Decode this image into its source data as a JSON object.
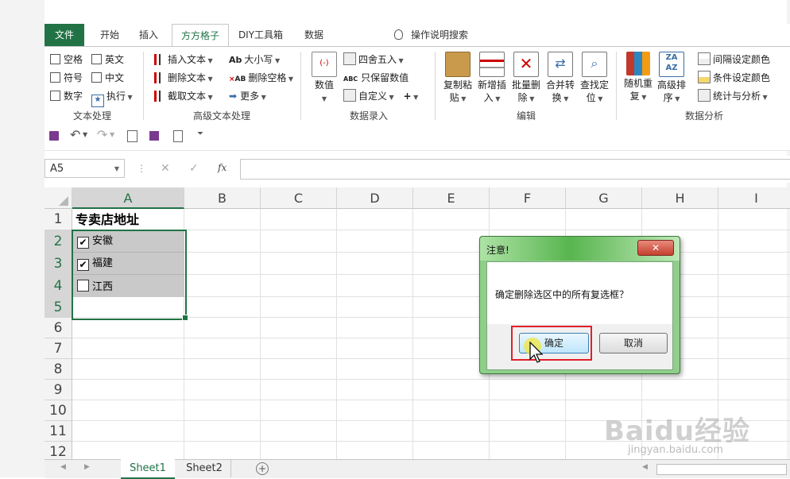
{
  "tabs": [
    "文件",
    "开始",
    "插入",
    "方方格子",
    "DIY工具箱",
    "数据"
  ],
  "tell_me": "操作说明搜索",
  "ribbon": {
    "text_group": {
      "label": "文本处理",
      "items": [
        "空格",
        "英文",
        "符号",
        "中文",
        "数字",
        "执行"
      ]
    },
    "adv_group": {
      "label": "高级文本处理",
      "items": [
        "插入文本",
        "删除文本",
        "截取文本",
        "大小写",
        "删除空格",
        "更多"
      ]
    },
    "num_group": {
      "label": "数据录入",
      "big": "数值",
      "items": [
        "四舍五入",
        "只保留数值",
        "自定义"
      ]
    },
    "edit_group": {
      "label": "编辑",
      "buttons": [
        [
          "复制粘",
          "贴"
        ],
        [
          "新增插",
          "入"
        ],
        [
          "批量删",
          "除"
        ],
        [
          "合并转",
          "换"
        ],
        [
          "查找定",
          "位"
        ]
      ]
    },
    "analysis_group": {
      "label": "数据分析",
      "buttons": [
        [
          "随机重",
          "复"
        ],
        [
          "高级排",
          "序"
        ]
      ],
      "items": [
        "间隔设定颜色",
        "条件设定颜色",
        "统计与分析"
      ]
    }
  },
  "name_box": "A5",
  "fx": "fx",
  "columns": [
    "A",
    "B",
    "C",
    "D",
    "E",
    "F",
    "G",
    "H",
    "I"
  ],
  "rows": [
    "1",
    "2",
    "3",
    "4",
    "5",
    "6",
    "7",
    "8",
    "9",
    "10",
    "11",
    "12"
  ],
  "cells": {
    "a1": "专卖店地址",
    "a2": "安徽",
    "a3": "福建",
    "a4": "江西"
  },
  "checks": {
    "a2": true,
    "a3": true,
    "a4": false
  },
  "sheets": [
    "Sheet1",
    "Sheet2"
  ],
  "dialog": {
    "title": "注意!",
    "message": "确定删除选区中的所有复选框？",
    "ok": "确定",
    "cancel": "取消"
  },
  "watermark": "Baidu经验",
  "watermark_sub": "jingyan.baidu.com",
  "colors": {
    "excel_green": "#217346",
    "highlight_red": "#e0202a"
  }
}
